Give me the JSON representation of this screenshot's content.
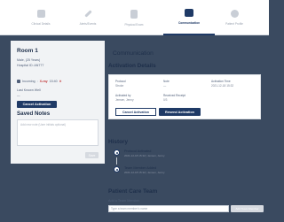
{
  "nav": {
    "tabs": [
      {
        "label": "Clinical Details",
        "icon": "clipboard-icon",
        "active": false
      },
      {
        "label": "Alerts/Events",
        "icon": "pen-icon",
        "active": false
      },
      {
        "label": "Physical Exam",
        "icon": "document-icon",
        "active": false
      },
      {
        "label": "Communication",
        "icon": "chat-icon",
        "active": true
      },
      {
        "label": "Patient Profile",
        "icon": "person-icon",
        "active": false
      }
    ]
  },
  "room": {
    "title": "Room 1",
    "demographics": "Male, (25 Years)",
    "hospital_id": "Hospital ID: AN777",
    "incoming_label": "Incoming",
    "incoming_status": "X-ray",
    "incoming_time": "15:40",
    "last_known_well_label": "Last Known Well",
    "last_known_well_value": "—",
    "cancel_activation": "Cancel Activation"
  },
  "saved_notes": {
    "title": "Saved Notes",
    "placeholder": "Add new note (User initials optional)",
    "save_label": "Save"
  },
  "communication": {
    "title": "Communication",
    "activation_details_title": "Activation Details",
    "fields": [
      {
        "label": "Protocol",
        "value": "Stroke"
      },
      {
        "label": "Note",
        "value": "—"
      },
      {
        "label": "Activation Time",
        "value": "2021-12-18 15:32"
      },
      {
        "label": "Activated by",
        "value": "Jensen, Jenny"
      },
      {
        "label": "Received Receipt",
        "value": "0/3"
      }
    ],
    "cancel_activation": "Cancel Activation",
    "resend_activation": "Resend Activation"
  },
  "history": {
    "title": "History",
    "items": [
      {
        "title": "Protocol Activated",
        "subtitle": "2021-12-18 15:32 | Jensen, Jenny"
      },
      {
        "title": "Team Member Added",
        "subtitle": "2021-12-18 15:32 | Jensen, Jenny"
      }
    ]
  },
  "patient_care_team": {
    "title": "Patient Care Team",
    "add_label": "Add a Team Member",
    "input_placeholder": "Type a team member's name",
    "add_button": "Add Team Member"
  }
}
